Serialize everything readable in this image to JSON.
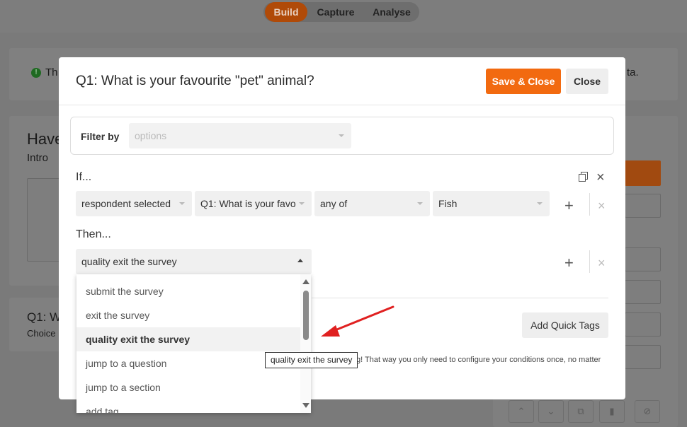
{
  "app": {
    "tabs": [
      {
        "label": "Build",
        "active": true
      },
      {
        "label": "Capture",
        "active": false
      },
      {
        "label": "Analyse",
        "active": false
      }
    ],
    "banner": {
      "left_text": "Th",
      "right_text": "ta."
    },
    "survey_card": {
      "title": "Have",
      "subtitle": "Intro"
    },
    "question_card": {
      "title": "Q1: W",
      "subtitle": "Choice"
    }
  },
  "modal": {
    "title": "Q1: What is your favourite \"pet\" animal?",
    "save_label": "Save & Close",
    "close_label": "Close",
    "filter": {
      "label": "Filter by",
      "placeholder": "options"
    },
    "if_label": "If...",
    "condition": {
      "subject": "respondent selected",
      "question": "Q1: What is your favo",
      "operator": "any of",
      "value": "Fish"
    },
    "then_label": "Then...",
    "action_value": "quality exit the survey",
    "add_tags_label": "Add Quick Tags",
    "help_text": "g! That way you only need to configure your conditions once, no matter"
  },
  "dropdown": {
    "options": [
      "submit the survey",
      "exit the survey",
      "quality exit the survey",
      "jump to a question",
      "jump to a section",
      "add tag"
    ],
    "selected_index": 2
  },
  "tooltip": {
    "text": "quality exit the survey"
  },
  "colors": {
    "accent": "#f26a10",
    "arrow": "#e02020"
  }
}
